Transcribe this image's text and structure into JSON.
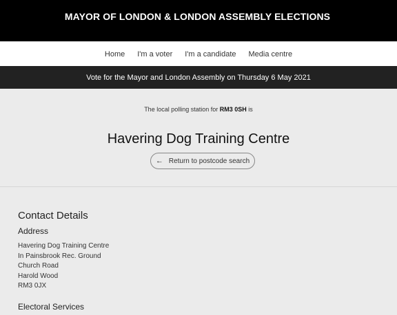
{
  "header": {
    "brand": "MAYOR OF LONDON & LONDON ASSEMBLY ELECTIONS"
  },
  "nav": {
    "items": [
      {
        "label": "Home"
      },
      {
        "label": "I'm a voter"
      },
      {
        "label": "I'm a candidate"
      },
      {
        "label": "Media centre"
      }
    ]
  },
  "banner": {
    "text": "Vote for the Mayor and London Assembly on Thursday 6 May 2021"
  },
  "result": {
    "intro_prefix": "The local polling station for",
    "postcode": "RM3 0SH",
    "intro_suffix": "is",
    "station_name": "Havering Dog Training Centre",
    "back_label": "Return to postcode search",
    "back_icon": "arrow-left-icon"
  },
  "contact": {
    "title": "Contact Details",
    "address_heading": "Address",
    "address_lines": [
      "Havering Dog Training Centre",
      "In Painsbrook Rec. Ground",
      "Church Road",
      "Harold Wood",
      "RM3 0JX"
    ],
    "electoral_heading": "Electoral Services"
  }
}
